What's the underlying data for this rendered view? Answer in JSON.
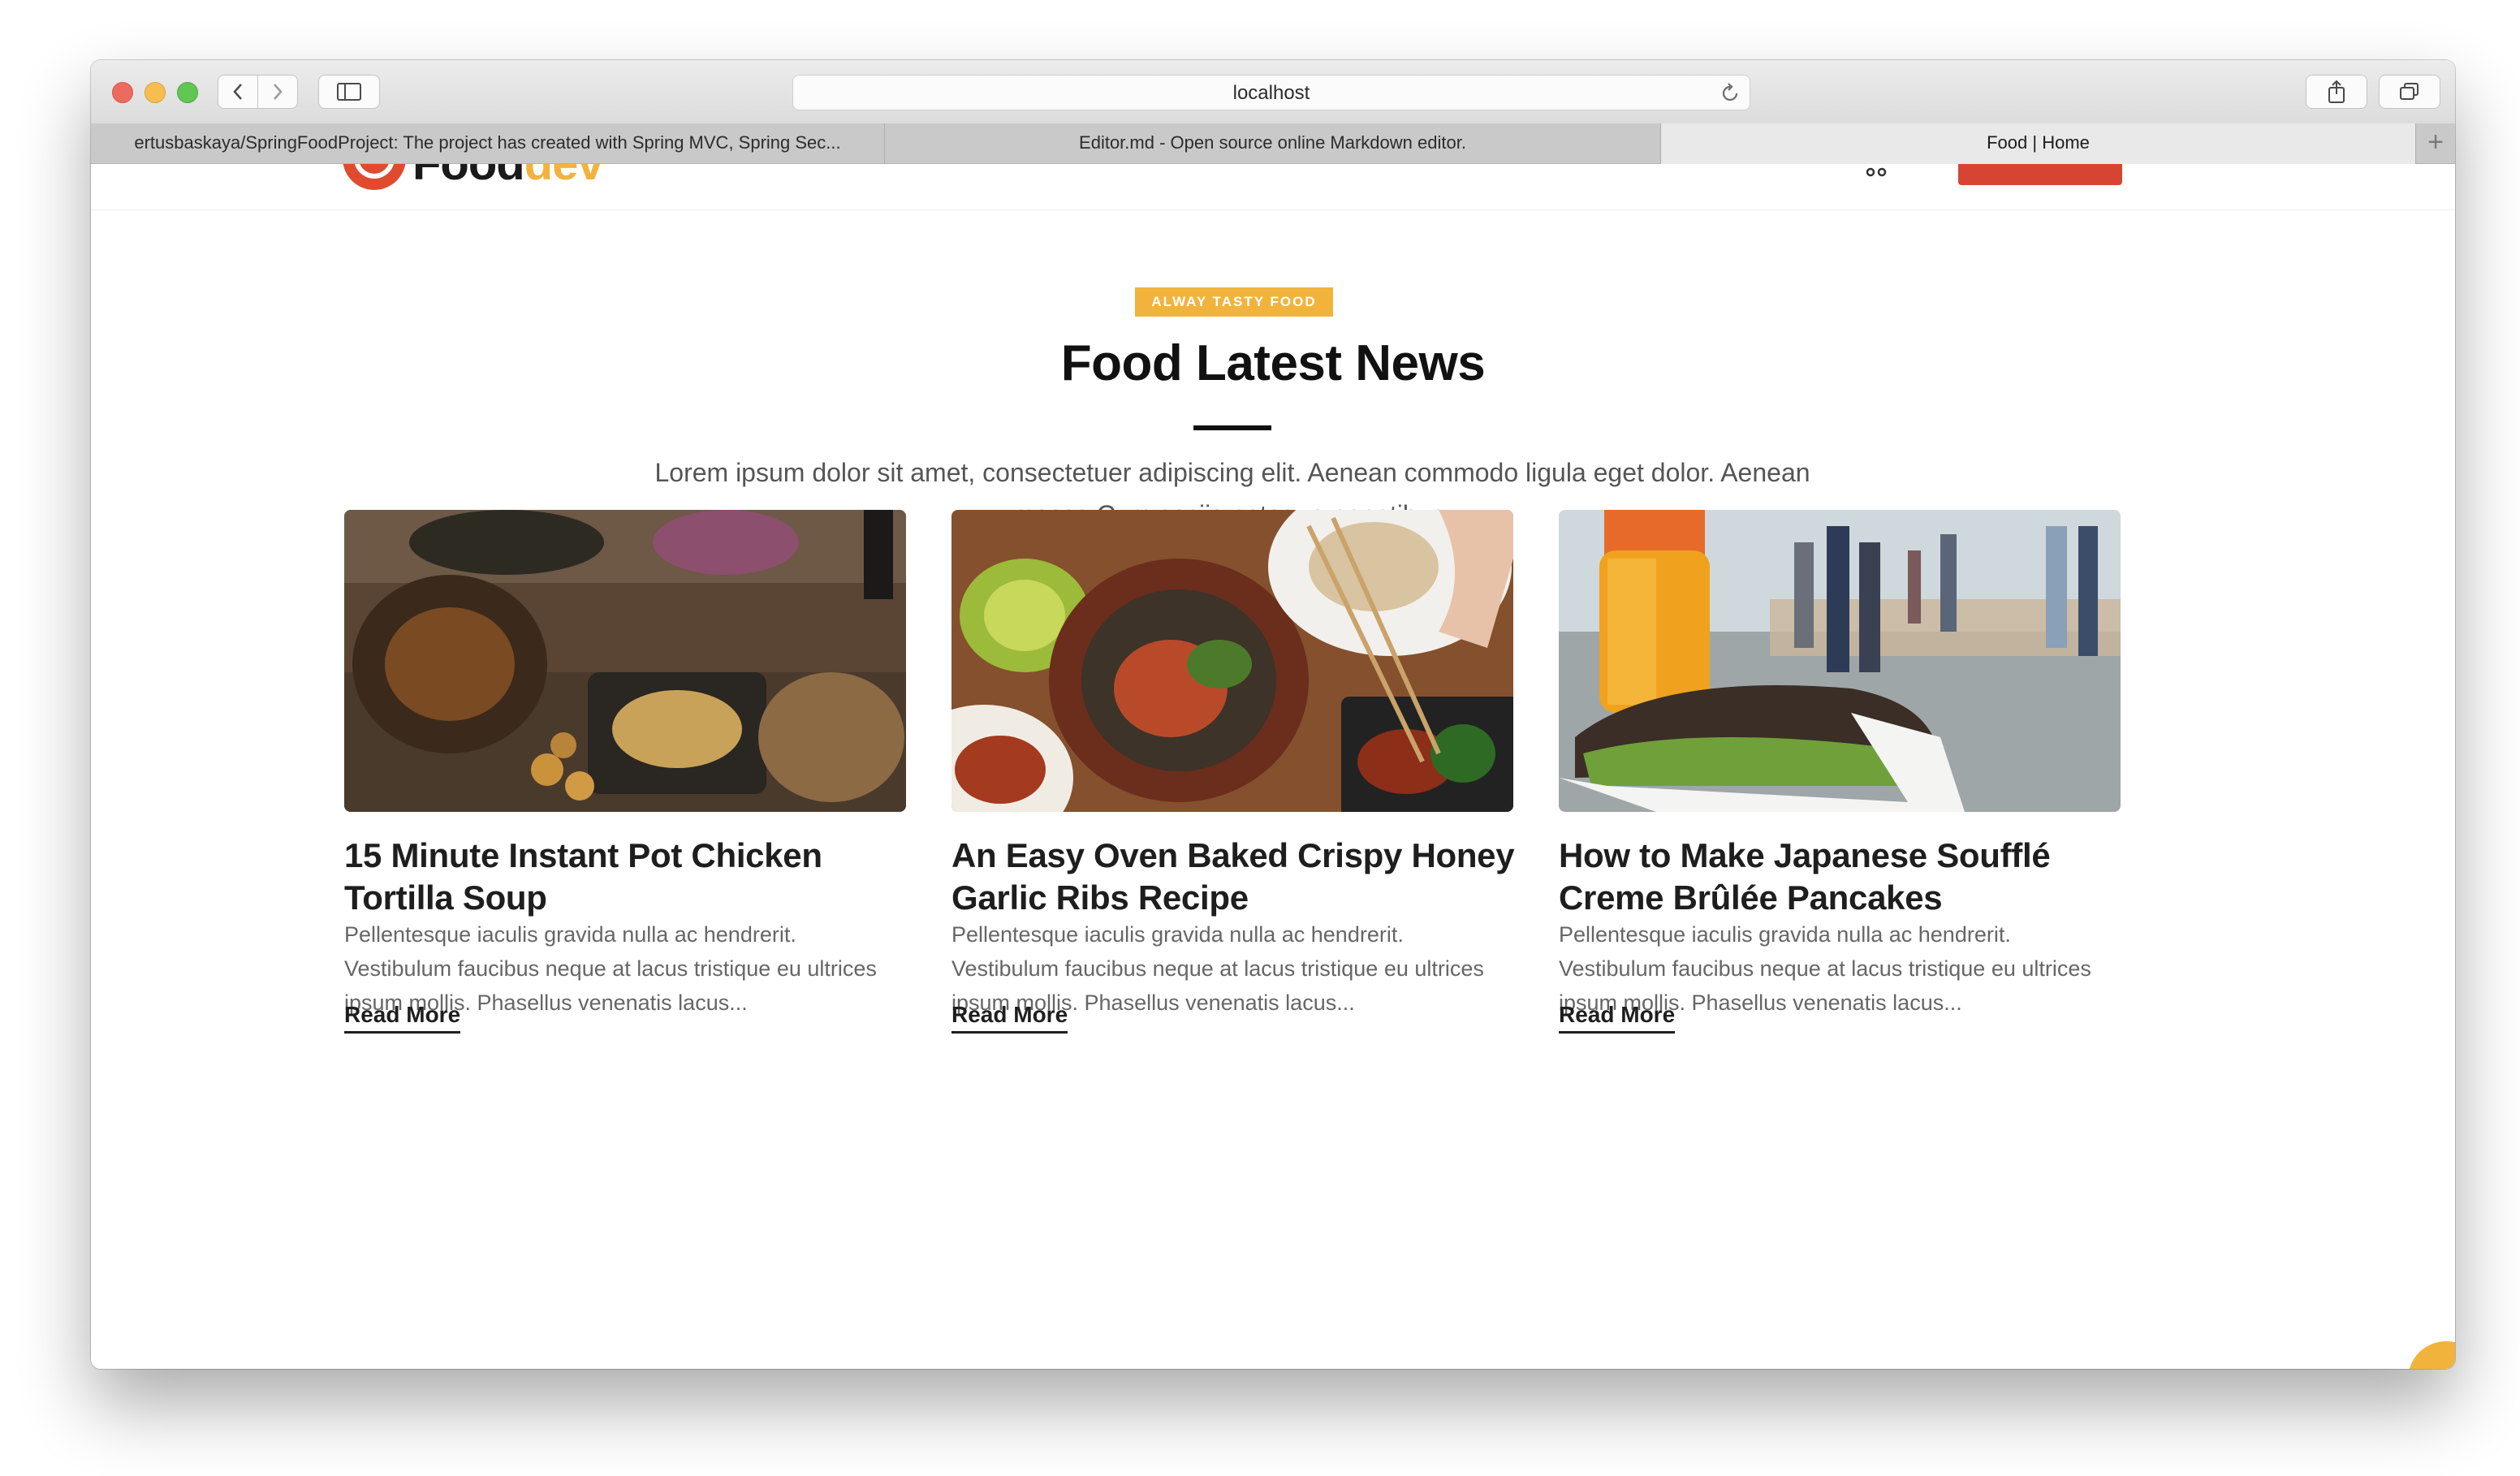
{
  "browser": {
    "address": "localhost",
    "tabs": [
      {
        "label": "ertusbaskaya/SpringFoodProject: The project has created with Spring MVC, Spring Sec...",
        "active": false
      },
      {
        "label": "Editor.md - Open source online Markdown editor.",
        "active": false
      },
      {
        "label": "Food | Home",
        "active": true
      }
    ],
    "new_tab": "+"
  },
  "header": {
    "logo_primary": "Food",
    "logo_accent": "dev",
    "accent_color": "#f2b33d",
    "brand_color": "#d64531"
  },
  "section": {
    "badge": "ALWAY TASTY FOOD",
    "title": "Food Latest News",
    "description": "Lorem ipsum dolor sit amet, consectetuer adipiscing elit. Aenean commodo ligula eget dolor. Aenean massa Cum sociis natoque penatibus."
  },
  "cards": [
    {
      "title": "15 Minute Instant Pot Chicken Tortilla Soup",
      "text": "Pellentesque iaculis gravida nulla ac hendrerit. Vestibulum faucibus neque at lacus tristique eu ultrices ipsum mollis. Phasellus venenatis lacus...",
      "link": "Read More"
    },
    {
      "title": "An Easy Oven Baked Crispy Honey Garlic Ribs Recipe",
      "text": "Pellentesque iaculis gravida nulla ac hendrerit. Vestibulum faucibus neque at lacus tristique eu ultrices ipsum mollis. Phasellus venenatis lacus...",
      "link": "Read More"
    },
    {
      "title": "How to Make Japanese Soufflé Creme Brûlée Pancakes",
      "text": "Pellentesque iaculis gravida nulla ac hendrerit. Vestibulum faucibus neque at lacus tristique eu ultrices ipsum mollis. Phasellus venenatis lacus...",
      "link": "Read More"
    }
  ]
}
